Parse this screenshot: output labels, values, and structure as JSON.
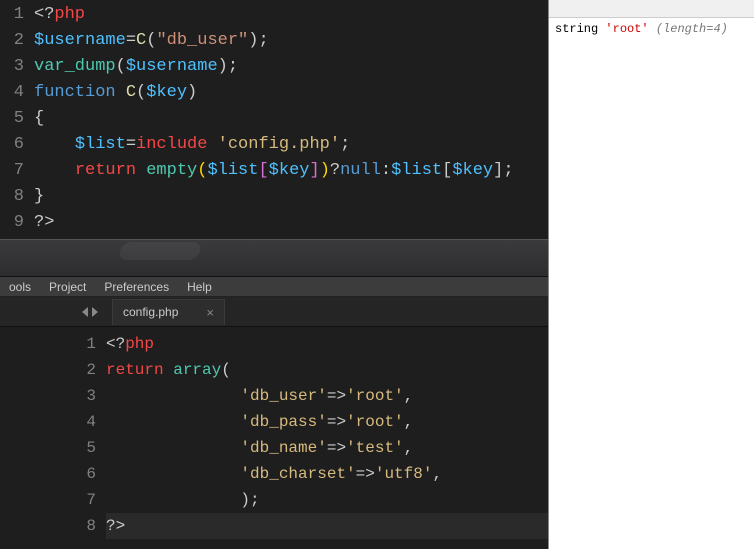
{
  "menu": {
    "items": [
      "ools",
      "Project",
      "Preferences",
      "Help"
    ]
  },
  "tab": {
    "filename": "config.php"
  },
  "editor_top": {
    "lines": [
      {
        "n": "1",
        "tokens": [
          {
            "t": "<?",
            "c": "k-punct"
          },
          {
            "t": "php",
            "c": "k-red"
          }
        ]
      },
      {
        "n": "2",
        "tokens": [
          {
            "t": "$username",
            "c": "k-var"
          },
          {
            "t": "=",
            "c": "k-punct"
          },
          {
            "t": "C",
            "c": "k-func"
          },
          {
            "t": "(",
            "c": "k-punct"
          },
          {
            "t": "\"db_user\"",
            "c": "k-str"
          },
          {
            "t": ")",
            "c": "k-punct"
          },
          {
            "t": ";",
            "c": "k-punct"
          }
        ]
      },
      {
        "n": "3",
        "tokens": [
          {
            "t": "var_dump",
            "c": "k-cyan"
          },
          {
            "t": "(",
            "c": "k-punct"
          },
          {
            "t": "$username",
            "c": "k-var"
          },
          {
            "t": ")",
            "c": "k-punct"
          },
          {
            "t": ";",
            "c": "k-punct"
          }
        ]
      },
      {
        "n": "4",
        "tokens": [
          {
            "t": "function ",
            "c": "k-blue"
          },
          {
            "t": "C",
            "c": "k-func"
          },
          {
            "t": "(",
            "c": "k-punct"
          },
          {
            "t": "$key",
            "c": "k-var"
          },
          {
            "t": ")",
            "c": "k-punct"
          }
        ]
      },
      {
        "n": "5",
        "tokens": [
          {
            "t": "{",
            "c": "k-punct"
          }
        ]
      },
      {
        "n": "6",
        "tokens": [
          {
            "t": "    ",
            "c": ""
          },
          {
            "t": "$list",
            "c": "k-var"
          },
          {
            "t": "=",
            "c": "k-punct"
          },
          {
            "t": "include ",
            "c": "k-red"
          },
          {
            "t": "'config.php'",
            "c": "k-str2"
          },
          {
            "t": ";",
            "c": "k-punct"
          }
        ]
      },
      {
        "n": "7",
        "tokens": [
          {
            "t": "    ",
            "c": ""
          },
          {
            "t": "return ",
            "c": "k-red"
          },
          {
            "t": "empty",
            "c": "k-cyan"
          },
          {
            "t": "(",
            "c": "k-paren"
          },
          {
            "t": "$list",
            "c": "k-var"
          },
          {
            "t": "[",
            "c": "k-paren2"
          },
          {
            "t": "$key",
            "c": "k-var"
          },
          {
            "t": "]",
            "c": "k-paren2"
          },
          {
            "t": ")",
            "c": "k-paren"
          },
          {
            "t": "?",
            "c": "k-punct"
          },
          {
            "t": "null",
            "c": "k-blue"
          },
          {
            "t": ":",
            "c": "k-punct"
          },
          {
            "t": "$list",
            "c": "k-var"
          },
          {
            "t": "[",
            "c": "k-punct"
          },
          {
            "t": "$key",
            "c": "k-var"
          },
          {
            "t": "]",
            "c": "k-punct"
          },
          {
            "t": ";",
            "c": "k-punct"
          }
        ]
      },
      {
        "n": "8",
        "tokens": [
          {
            "t": "}",
            "c": "k-punct"
          }
        ]
      },
      {
        "n": "9",
        "tokens": [
          {
            "t": "?>",
            "c": "k-punct"
          }
        ]
      }
    ]
  },
  "editor_bottom": {
    "lines": [
      {
        "n": "1",
        "tokens": [
          {
            "t": "<?",
            "c": "k-punct"
          },
          {
            "t": "php",
            "c": "k-red"
          }
        ]
      },
      {
        "n": "2",
        "tokens": [
          {
            "t": "return ",
            "c": "k-red"
          },
          {
            "t": "array",
            "c": "k-cyan"
          },
          {
            "t": "(",
            "c": "k-punct"
          }
        ]
      },
      {
        "n": "3",
        "tokens": [
          {
            "t": "              ",
            "c": ""
          },
          {
            "t": "'db_user'",
            "c": "k-str2"
          },
          {
            "t": "=>",
            "c": "k-punct"
          },
          {
            "t": "'root'",
            "c": "k-str2"
          },
          {
            "t": ",",
            "c": "k-punct"
          }
        ]
      },
      {
        "n": "4",
        "tokens": [
          {
            "t": "              ",
            "c": ""
          },
          {
            "t": "'db_pass'",
            "c": "k-str2"
          },
          {
            "t": "=>",
            "c": "k-punct"
          },
          {
            "t": "'root'",
            "c": "k-str2"
          },
          {
            "t": ",",
            "c": "k-punct"
          }
        ]
      },
      {
        "n": "5",
        "tokens": [
          {
            "t": "              ",
            "c": ""
          },
          {
            "t": "'db_name'",
            "c": "k-str2"
          },
          {
            "t": "=>",
            "c": "k-punct"
          },
          {
            "t": "'test'",
            "c": "k-str2"
          },
          {
            "t": ",",
            "c": "k-punct"
          }
        ]
      },
      {
        "n": "6",
        "tokens": [
          {
            "t": "              ",
            "c": ""
          },
          {
            "t": "'db_charset'",
            "c": "k-str2"
          },
          {
            "t": "=>",
            "c": "k-punct"
          },
          {
            "t": "'utf8'",
            "c": "k-str2"
          },
          {
            "t": ",",
            "c": "k-punct"
          }
        ]
      },
      {
        "n": "7",
        "tokens": [
          {
            "t": "              ",
            "c": ""
          },
          {
            "t": ");",
            "c": "k-punct"
          }
        ]
      },
      {
        "n": "8",
        "tokens": [
          {
            "t": "?>",
            "c": "k-punct"
          }
        ],
        "current": true
      }
    ]
  },
  "output": {
    "prefix": "string ",
    "value": "'root'",
    "length": "(length=4)"
  }
}
